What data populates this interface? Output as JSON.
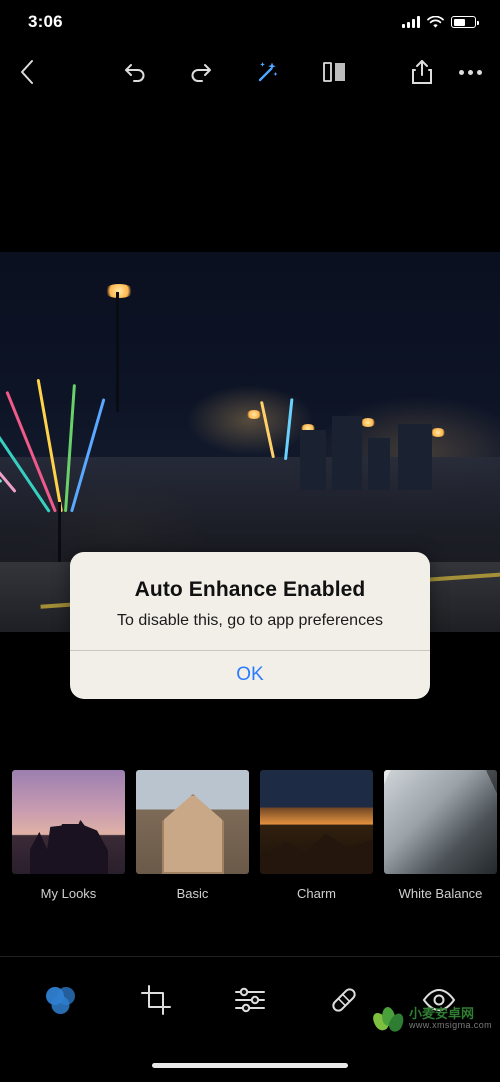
{
  "status_bar": {
    "time": "3:06",
    "signal_icon": "cellular-bars-icon",
    "wifi_icon": "wifi-icon",
    "battery_icon": "battery-icon"
  },
  "toolbar": {
    "back_icon": "chevron-left-icon",
    "undo_icon": "undo-icon",
    "redo_icon": "redo-icon",
    "auto_enhance_icon": "magic-wand-icon",
    "compare_icon": "before-after-compare-icon",
    "share_icon": "share-icon",
    "more_icon": "more-options-icon"
  },
  "alert": {
    "title": "Auto Enhance Enabled",
    "message": "To disable this, go to app preferences",
    "confirm_label": "OK"
  },
  "presets": {
    "items": [
      {
        "label": "My Looks",
        "thumb": "th-mylooks"
      },
      {
        "label": "Basic",
        "thumb": "th-basic"
      },
      {
        "label": "Charm",
        "thumb": "th-charm"
      },
      {
        "label": "White Balance",
        "thumb": "th-wb"
      }
    ]
  },
  "bottom_bar": {
    "items": [
      {
        "name": "looks-tool",
        "icon": "three-circles-icon",
        "active": true
      },
      {
        "name": "crop-tool",
        "icon": "crop-icon",
        "active": false
      },
      {
        "name": "adjust-tool",
        "icon": "sliders-icon",
        "active": false
      },
      {
        "name": "heal-tool",
        "icon": "bandage-icon",
        "active": false
      },
      {
        "name": "selective-tool",
        "icon": "eye-icon",
        "active": false
      }
    ]
  },
  "watermark": {
    "cn": "小麦安卓网",
    "en": "www.xmsigma.com"
  },
  "colors": {
    "accent_blue": "#2b7bff",
    "alert_bg": "#f2efe9",
    "tool_active": "#2f7fd0",
    "background": "#000000"
  },
  "home_indicator": "home-bar"
}
